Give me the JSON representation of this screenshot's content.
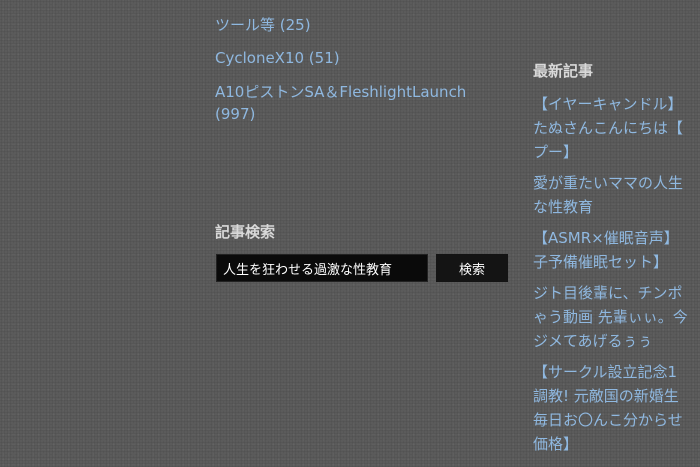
{
  "categories": {
    "items": [
      {
        "label": "ツール等 (25)"
      },
      {
        "label": "CycloneX10 (51)"
      },
      {
        "label_line1": "A10ピストンSA＆FleshlightLaunch",
        "label_line2": "(997)"
      }
    ]
  },
  "search": {
    "title": "記事検索",
    "input_value": "人生を狂わせる過激な性教育",
    "button_label": "検索"
  },
  "recent": {
    "title": "最新記事",
    "items": [
      {
        "lines": [
          "【イヤーキャンドル】",
          "たぬさんこんにちは【",
          "プー】"
        ]
      },
      {
        "lines": [
          "愛が重たいママの人生",
          "な性教育"
        ]
      },
      {
        "lines": [
          "【ASMR×催眠音声】",
          "子予備催眠セット】"
        ]
      },
      {
        "lines": [
          "ジト目後輩に、チンポ",
          "ゃう動画 先輩ぃぃ。今",
          "ジメてあげるぅぅ"
        ]
      },
      {
        "lines": [
          "【サークル設立記念1",
          "調教! 元敵国の新婚生",
          "毎日お〇んこ分からせ",
          "価格】"
        ]
      }
    ]
  },
  "colors": {
    "link": "#8fb8e0",
    "heading": "#d8d8d8",
    "background": "#5b5b5b",
    "input_bg": "#0a0a0a"
  }
}
